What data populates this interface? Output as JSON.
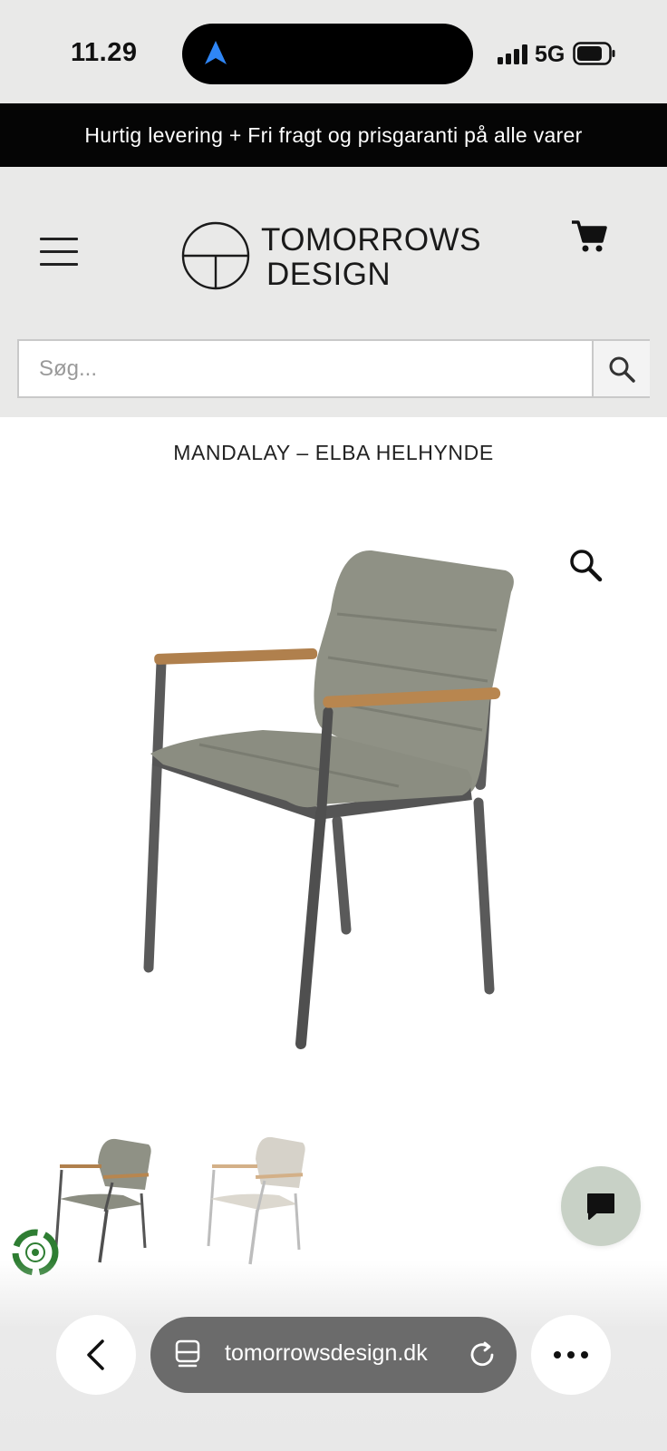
{
  "status_bar": {
    "time": "11.29",
    "network": "5G",
    "icons": [
      "location-arrow-icon",
      "signal-bars-icon",
      "battery-icon"
    ]
  },
  "promo": {
    "text": "Hurtig levering + Fri fragt og prisgaranti på alle varer"
  },
  "header": {
    "logo_line1": "TOMORROWS",
    "logo_line2": "DESIGN",
    "icons": [
      "hamburger-menu-icon",
      "cart-icon"
    ]
  },
  "search": {
    "placeholder": "Søg...",
    "icon": "search-icon"
  },
  "product": {
    "title": "MANDALAY – ELBA HELHYNDE",
    "zoom_icon": "magnifier-icon"
  },
  "floating": {
    "chat_icon": "chat-bubble-icon",
    "badge_icon": "recycle-badge-icon"
  },
  "browser": {
    "url": "tomorrowsdesign.dk",
    "icons": [
      "back-chevron-icon",
      "page-icon",
      "reload-icon",
      "more-dots-icon"
    ]
  },
  "colors": {
    "header_bg": "#e9e9e8",
    "banner_bg": "#050505",
    "chat_bg": "#c8d1c6",
    "address_bg": "#6b6b6b"
  }
}
